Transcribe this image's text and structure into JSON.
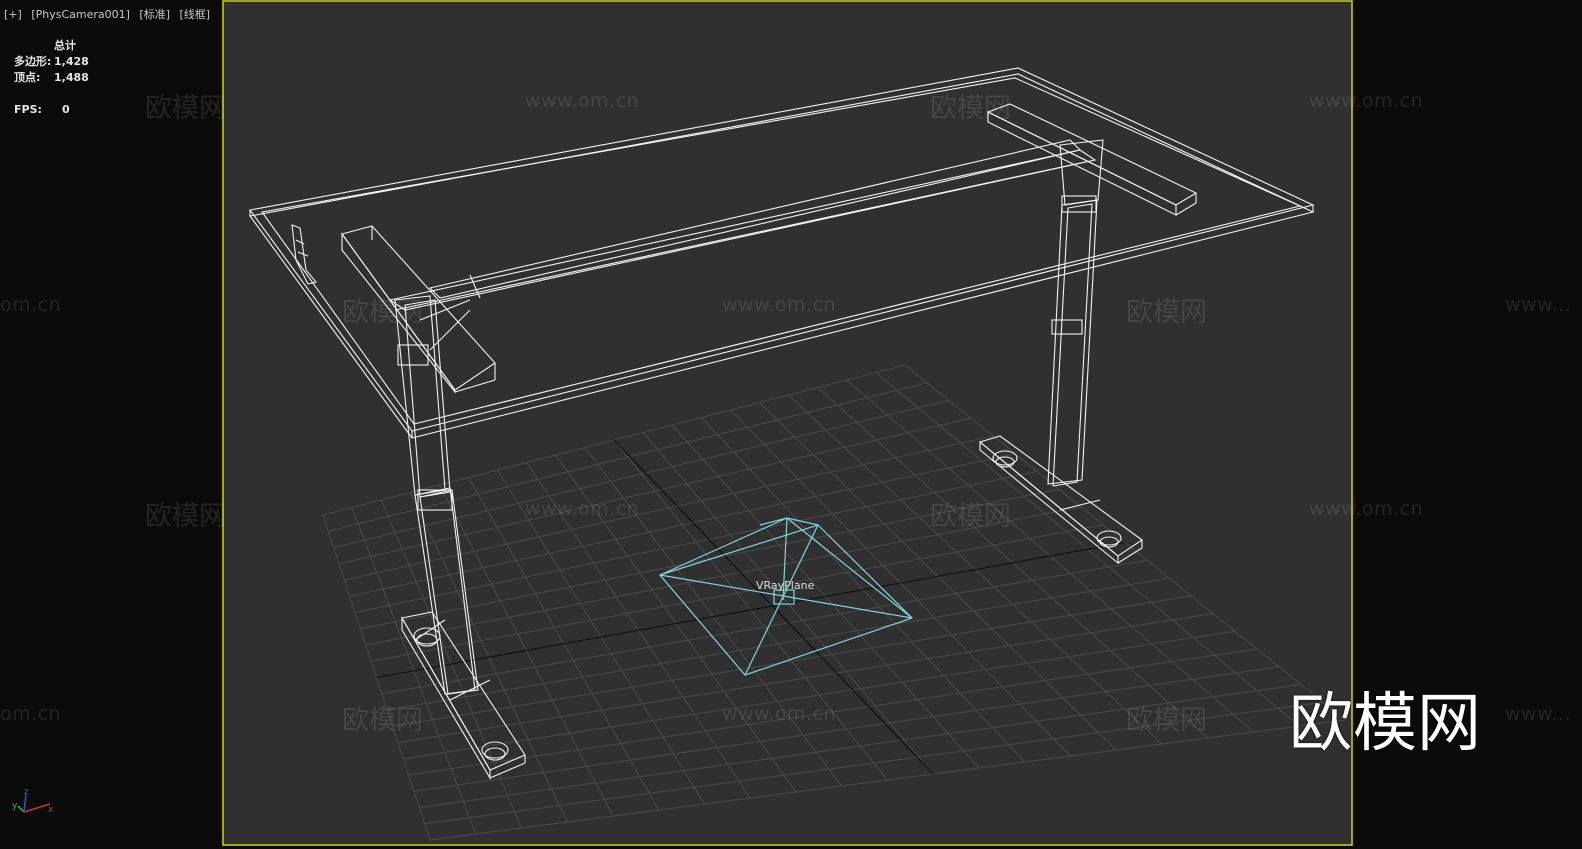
{
  "viewport": {
    "labels": [
      "[+]",
      "[PhysCamera001]",
      "[标准]",
      "[线框]"
    ],
    "border_color": "#d4d400",
    "background": "#303030"
  },
  "stats": {
    "header": "总计",
    "polygons_label": "多边形:",
    "polygons_value": "1,428",
    "vertices_label": "顶点:",
    "vertices_value": "1,488",
    "fps_label": "FPS:",
    "fps_value": "0"
  },
  "scene": {
    "light_label": "VRayPlane",
    "light_color": "#7fd6d6",
    "wire_color": "#f2f2f2",
    "grid_color": "#4a4a4a",
    "grid_axis_color": "#111111"
  },
  "watermarks": {
    "url": "www.om.cn",
    "brand": "欧模网",
    "url_partial": "www...",
    "url_tail": "om.cn"
  },
  "gizmo": {
    "x": "x",
    "y": "y",
    "z": "z"
  }
}
